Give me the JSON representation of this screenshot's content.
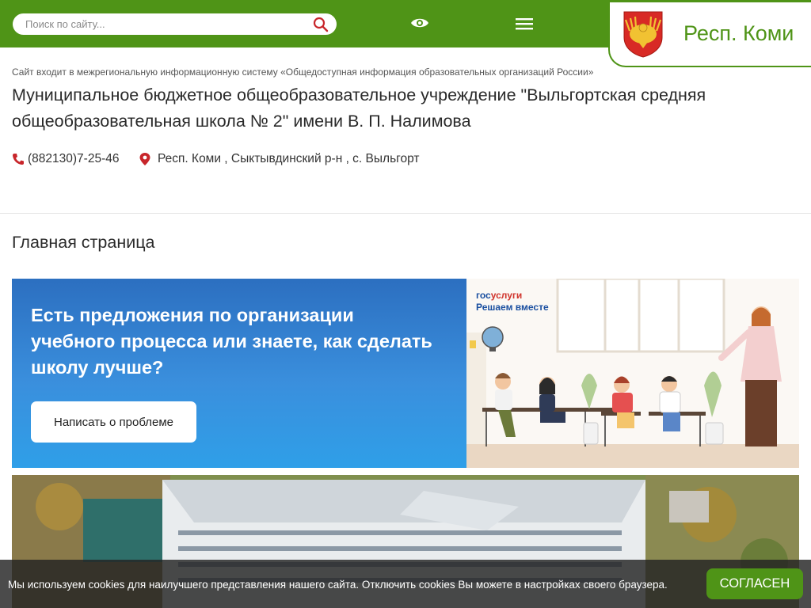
{
  "header": {
    "search_placeholder": "Поиск по сайту...",
    "icons": [
      "search-icon",
      "eye-icon",
      "menu-icon"
    ],
    "region_name": "Респ. Коми",
    "brand_color": "#4f9417"
  },
  "info_line": "Сайт входит в межрегиональную информационную систему «Общедоступная информация образовательных организаций России»",
  "org_title": "Муниципальное бюджетное общеобразовательное учреждение \"Выльгортская средняя общеобразовательная школа № 2\" имени В. П. Налимова",
  "contacts": {
    "phone": "(882130)7-25-46",
    "address": "Респ. Коми , Сыктывдинский р-н , с. Выльгорт"
  },
  "page_title": "Главная страница",
  "banner": {
    "text": "Есть предложения по организации учебного процесса или знаете, как сделать школу лучше?",
    "button_label": "Написать о проблеме",
    "logo_part1": "гос",
    "logo_part2": "услуги",
    "logo_sub": "Решаем вместе"
  },
  "cookie": {
    "text": "Мы используем cookies для наилучшего представления нашего сайта. Отключить cookies Вы можете в настройках своего браузера.",
    "button_label": "СОГЛАСЕН"
  }
}
